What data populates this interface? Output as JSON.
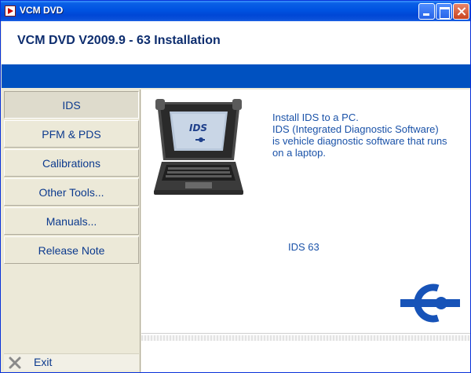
{
  "window": {
    "title": "VCM DVD"
  },
  "header": {
    "title": "VCM DVD V2009.9 - 63 Installation"
  },
  "sidebar": {
    "items": [
      {
        "label": "IDS",
        "active": true
      },
      {
        "label": "PFM & PDS",
        "active": false
      },
      {
        "label": "Calibrations",
        "active": false
      },
      {
        "label": "Other Tools...",
        "active": false
      },
      {
        "label": "Manuals...",
        "active": false
      },
      {
        "label": "Release Note",
        "active": false
      }
    ],
    "exit_label": "Exit"
  },
  "content": {
    "description_lines": [
      "Install IDS to a PC.",
      "IDS (Integrated Diagnostic Software)",
      "is vehicle diagnostic software that runs",
      "on a laptop."
    ],
    "screen_label": "IDS",
    "version": "IDS 63"
  },
  "colors": {
    "titlebar": "#0053e1",
    "header_text": "#0d2d6e",
    "blue_band": "#0051c0",
    "nav_text": "#0c3a8e",
    "content_text": "#1a52a8",
    "logo": "#1753b8"
  },
  "icons": {
    "app": "app-icon",
    "exit": "x-icon",
    "laptop": "laptop-image",
    "brand": "brand-logo"
  }
}
